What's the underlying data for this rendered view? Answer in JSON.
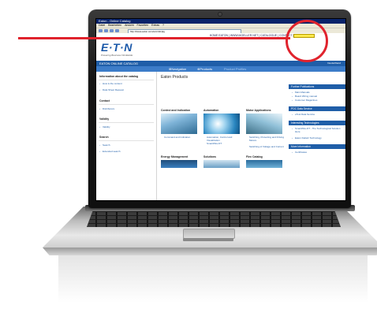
{
  "browser": {
    "title": "Eaton - Online Catalog",
    "menu": [
      "Datei",
      "Bearbeiten",
      "Ansicht",
      "Favoriten",
      "Extras",
      "?"
    ],
    "address": "http://www.eaton.com/ecm/idcplg"
  },
  "site": {
    "top_links": "HOME EATON | WWW.MOELLER.NET | CATALOGUE | CONTACT | SEARCH",
    "logo": "E·T·N",
    "tagline": "Powering Business Worldwide",
    "catalog_title": "EATON ONLINE CATALOG",
    "catalog_right": "Deutschland",
    "nav": {
      "navigation": "Navigation",
      "products": "Products",
      "product_profiles": "Product Profiles"
    }
  },
  "left": {
    "info_head": "Information about the catalog",
    "info_links": [
      "How is the content",
      "Data Sheet Request"
    ],
    "contact_head": "Contact",
    "contact_links": [
      "Distributors"
    ],
    "validity_head": "Validity",
    "validity_links": [
      "Validity"
    ],
    "search_head": "Search",
    "search_links": [
      "Search",
      "Extended search"
    ]
  },
  "main": {
    "title": "Eaton Products",
    "sections": [
      {
        "title": "Control and Indication",
        "links": [
          "Command and Indication"
        ]
      },
      {
        "title": "Automation",
        "links": [
          "Automation, Control and Visualization",
          "SmartWire-DT"
        ]
      },
      {
        "title": "Motor Applications",
        "links": [
          "Switching, Protecting and Driving Motors",
          "Switching of Voltage and Current"
        ]
      },
      {
        "title": "Energy Management",
        "links": []
      },
      {
        "title": "Solutions",
        "links": []
      },
      {
        "title": "Flex Catalog",
        "links": []
      }
    ]
  },
  "right": {
    "panels": [
      {
        "head": "Further Publications",
        "links": [
          "Main Manuals",
          "Board Wiring manual",
          "Customer Magazines"
        ]
      },
      {
        "head": "PDC Data Service",
        "links": [
          "eTool Data Service"
        ]
      },
      {
        "head": "Interesting Technologies",
        "links": [
          "SmartWire-DT - The Technological Solution Here",
          "Eaton DeltaC Technology"
        ]
      },
      {
        "head": "More Information",
        "links": [
          "Certificates"
        ]
      }
    ]
  },
  "annotation": {
    "color": "#e0232d",
    "target": "search field"
  }
}
